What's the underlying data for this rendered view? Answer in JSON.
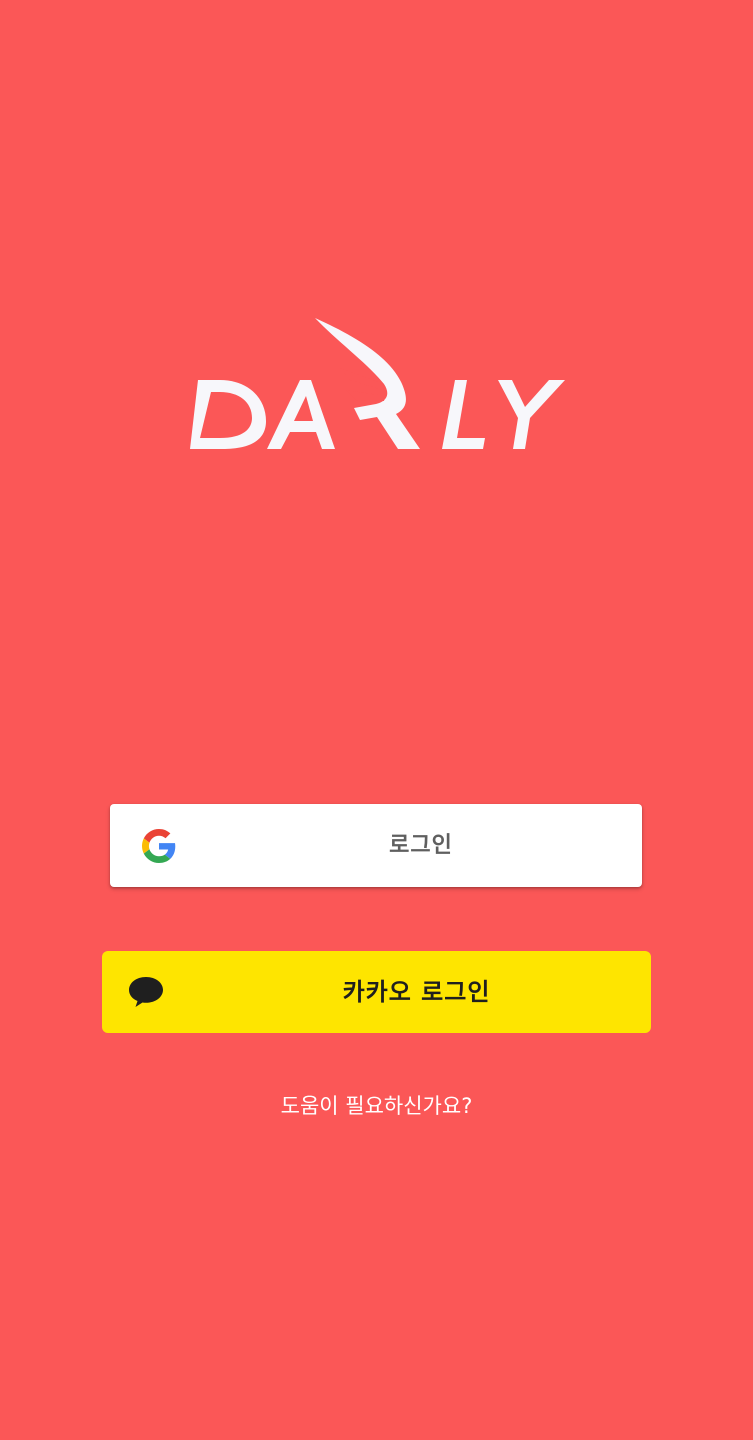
{
  "app": {
    "background_color": "#fb5757",
    "logo_text": "DARLY",
    "logo_color": "#f7f7fb"
  },
  "google_login": {
    "icon": "google-g-icon",
    "label": "로그인",
    "background_color": "#ffffff",
    "text_color": "#5f5f5f"
  },
  "kakao_login": {
    "icon": "speech-bubble-icon",
    "label": "카카오 로그인",
    "background_color": "#fee500",
    "text_color": "#1f1f1f"
  },
  "help": {
    "label": "도움이 필요하신가요?"
  }
}
